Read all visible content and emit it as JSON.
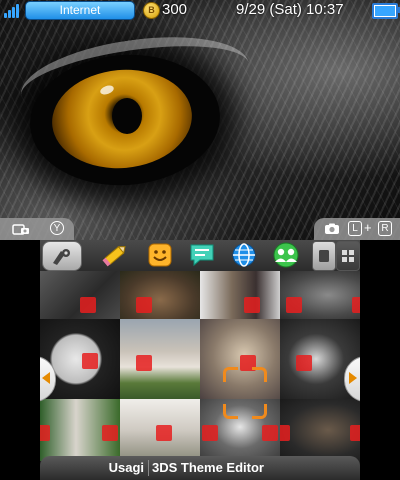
{
  "status_bar": {
    "connection_label": "Internet",
    "coin_symbol": "B",
    "coin_count": "300",
    "datetime": "9/29 (Sat) 10:37",
    "battery_level": 0.9
  },
  "top_controls": {
    "y_button_label": "Y",
    "l_label": "L",
    "plus_label": "+",
    "r_label": "R"
  },
  "toolbar": {
    "icons": [
      "settings-icon",
      "pencil-icon",
      "mii-smile-icon",
      "notification-icon",
      "internet-browser-icon",
      "friend-list-icon",
      "large-view-icon",
      "grid-view-icon"
    ]
  },
  "theme": {
    "author": "Usagi",
    "title": "3DS Theme Editor"
  },
  "colors": {
    "accent_blue": "#37a6ff",
    "selection_orange": "#f08a1c",
    "tile_red": "#e61e1e"
  }
}
